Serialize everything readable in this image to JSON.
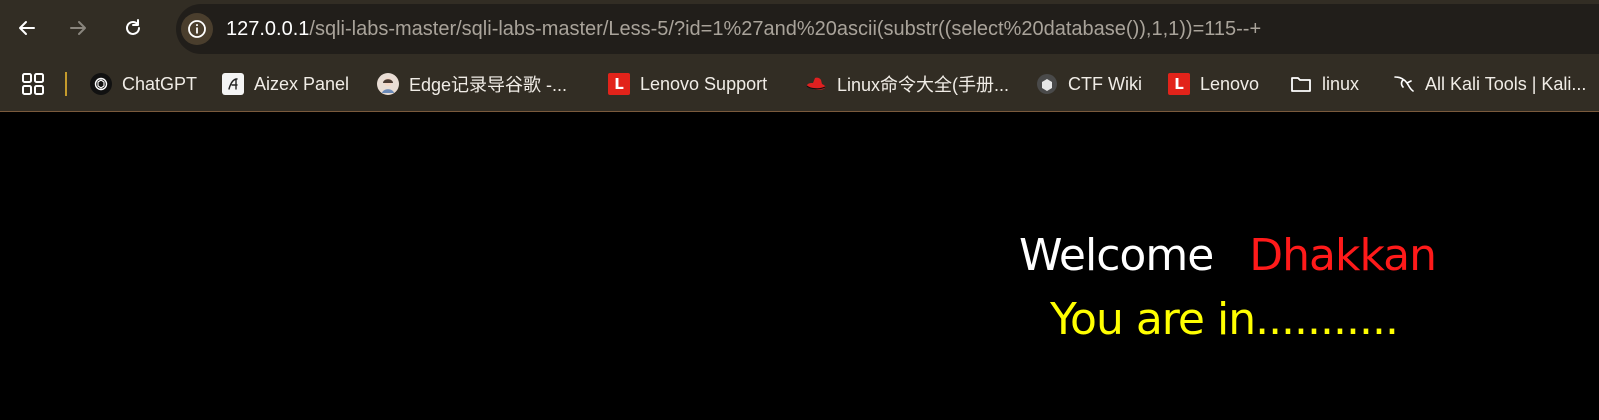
{
  "browser": {
    "url_host": "127.0.0.1",
    "url_rest": "/sqli-labs-master/sqli-labs-master/Less-5/?id=1%27and%20ascii(substr((select%20database()),1,1))=115--+"
  },
  "bookmarks": [
    {
      "label": "ChatGPT",
      "icon": "chatgpt-icon"
    },
    {
      "label": "Aizex Panel",
      "icon": "aizex-icon"
    },
    {
      "label": "Edge记录导谷歌 -...",
      "icon": "avatar-icon"
    },
    {
      "label": "Lenovo Support",
      "icon": "lenovo-icon"
    },
    {
      "label": "Linux命令大全(手册...",
      "icon": "redhat-icon"
    },
    {
      "label": "CTF Wiki",
      "icon": "ctf-wiki-icon"
    },
    {
      "label": "Lenovo",
      "icon": "lenovo-icon"
    },
    {
      "label": "linux",
      "icon": "folder-icon"
    },
    {
      "label": "All Kali Tools | Kali...",
      "icon": "kali-icon"
    }
  ],
  "page": {
    "welcome": "Welcome",
    "user": "Dhakkan",
    "status": "You are in..........."
  },
  "colors": {
    "chrome_bg": "#322d24",
    "omnibox_bg": "#211e1a",
    "welcome": "#ffffff",
    "user": "#ff1a1a",
    "status": "#ffff00"
  }
}
